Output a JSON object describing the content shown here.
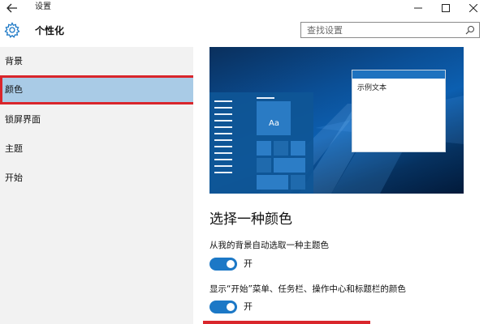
{
  "window": {
    "title": "设置"
  },
  "header": {
    "title": "个性化",
    "search_placeholder": "查找设置"
  },
  "sidebar": {
    "items": [
      {
        "label": "背景"
      },
      {
        "label": "颜色",
        "selected": true
      },
      {
        "label": "锁屏界面"
      },
      {
        "label": "主题"
      },
      {
        "label": "开始"
      }
    ]
  },
  "preview": {
    "tile_label": "Aa",
    "sample_text": "示例文本"
  },
  "main": {
    "section_title": "选择一种颜色",
    "options": [
      {
        "label": "从我的背景自动选取一种主题色",
        "toggle_text": "开",
        "on": true
      },
      {
        "label": "显示“开始”菜单、任务栏、操作中心和标题栏的颜色",
        "toggle_text": "开",
        "on": true
      }
    ]
  },
  "colors": {
    "accent": "#1c78c6",
    "selected_bg": "#a9cbe6",
    "highlight_border": "#d9262c",
    "sidebar_bg": "#f2f2f2"
  }
}
